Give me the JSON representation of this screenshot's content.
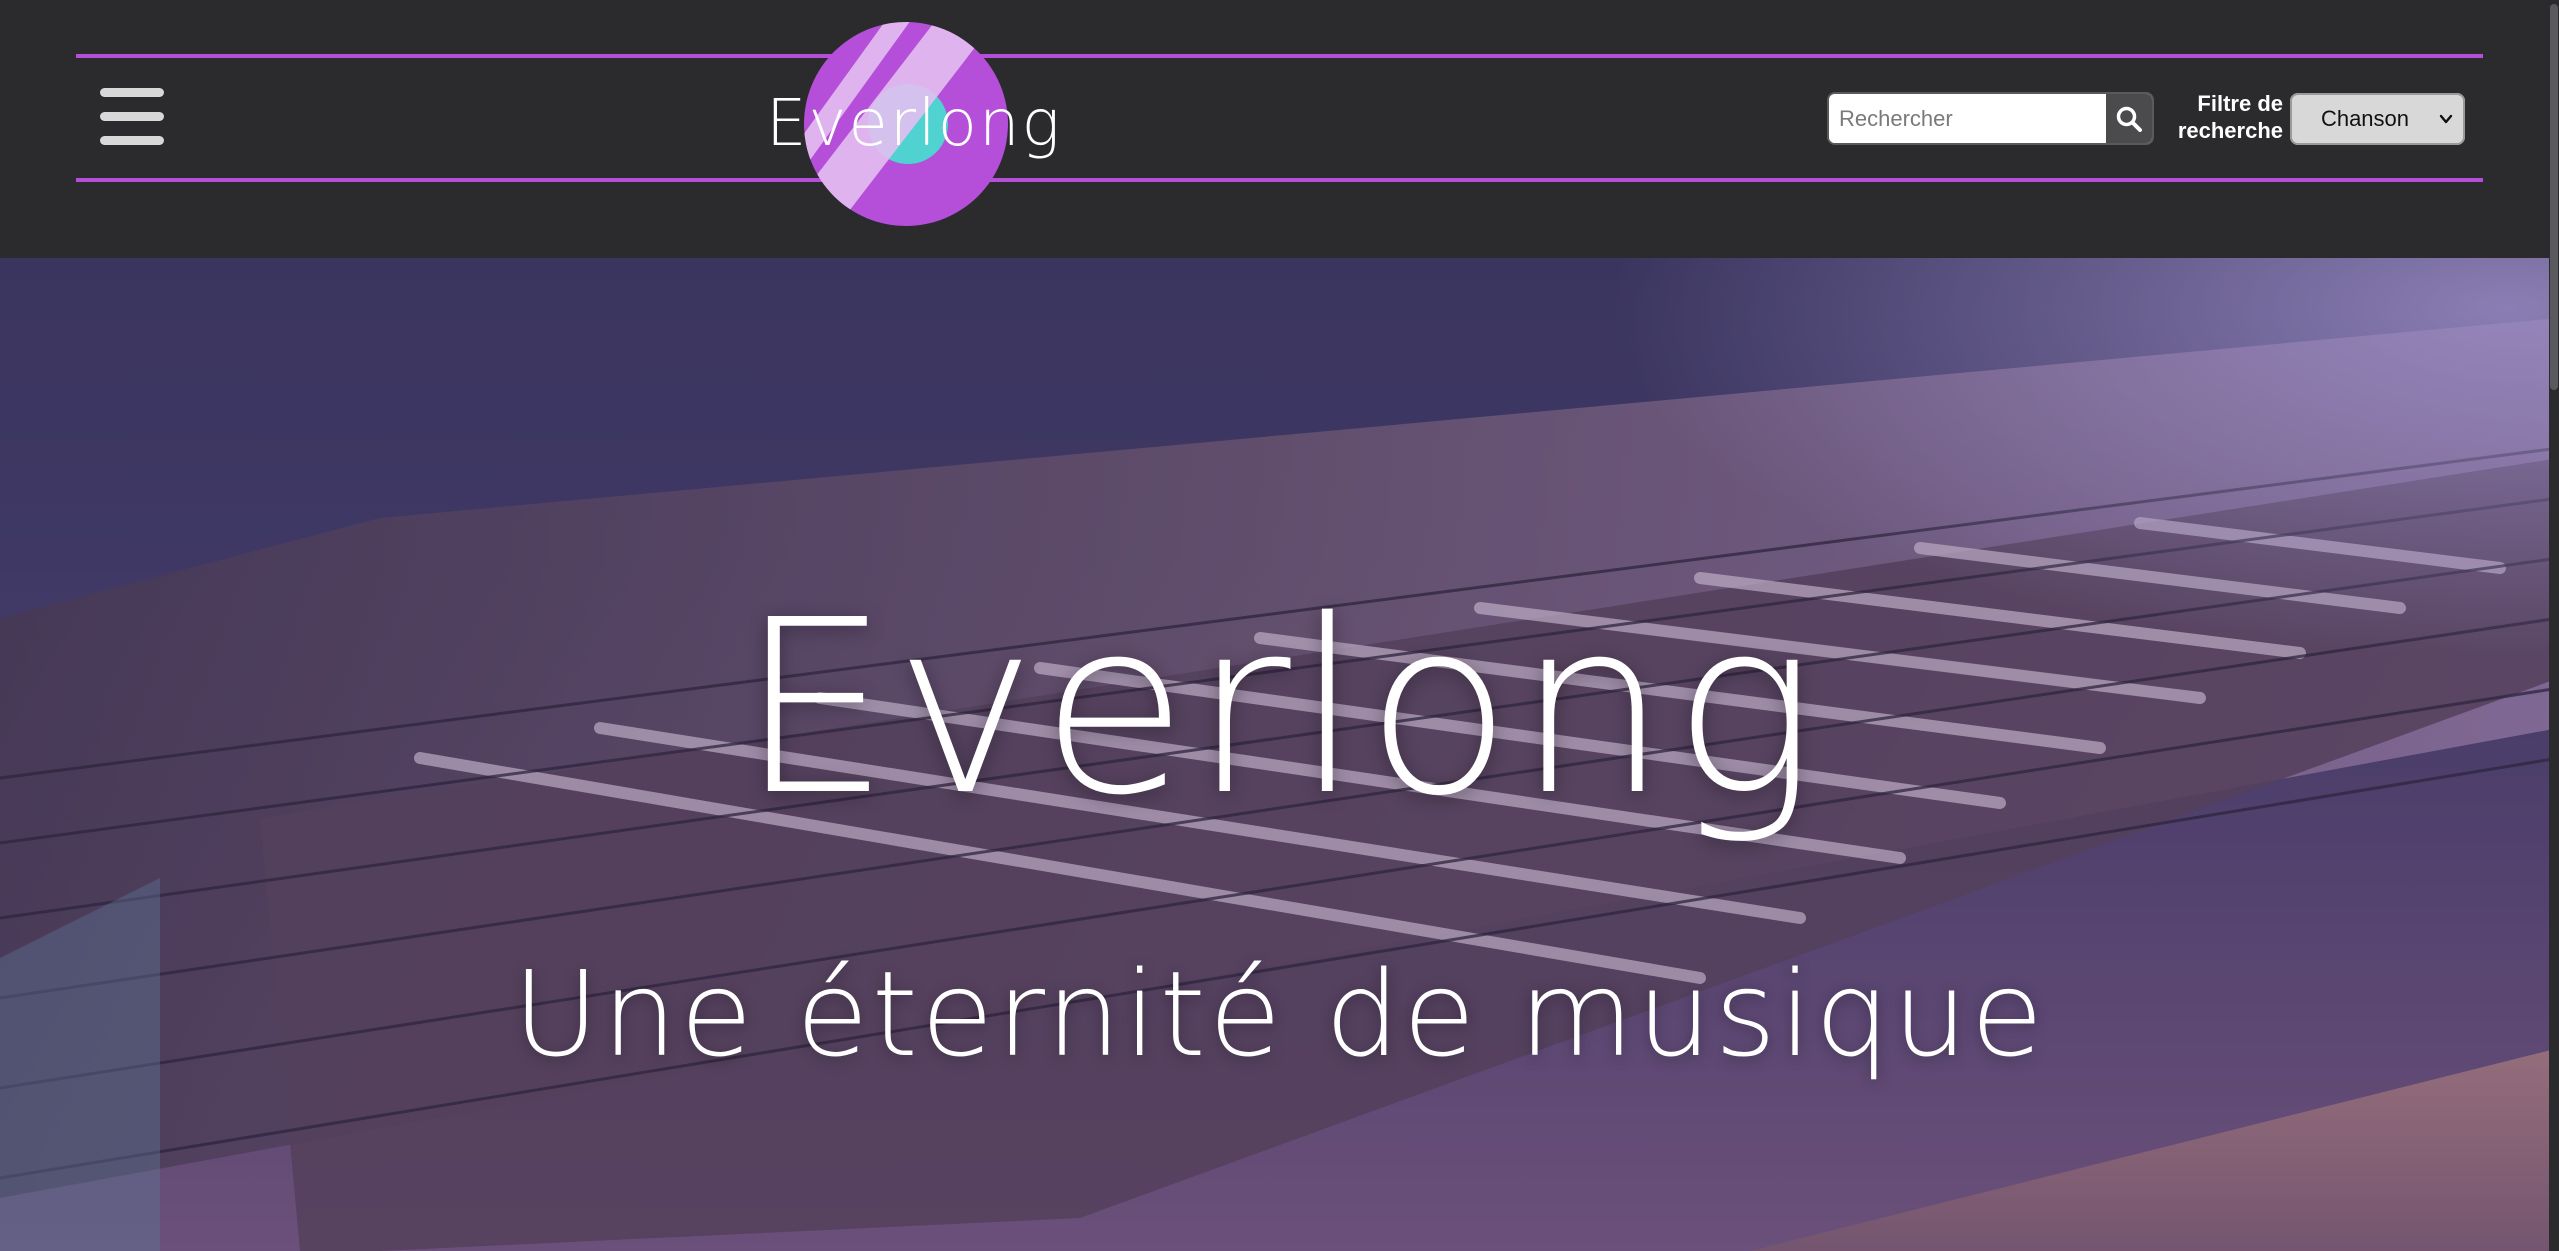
{
  "header": {
    "logo_text": "Everlong",
    "menu_icon": "hamburger-menu-icon",
    "search": {
      "placeholder": "Rechercher",
      "value": "",
      "button_icon": "search-icon"
    },
    "filter": {
      "label": "Filtre de recherche",
      "selected": "Chanson",
      "chevron_icon": "chevron-down-icon"
    }
  },
  "hero": {
    "title": "Everlong",
    "subtitle": "Une éternité de musique",
    "background": "guitar-fretboard-image"
  },
  "colors": {
    "header_bg": "#2b2b2d",
    "accent": "#b54fd9",
    "logo_circle": "#b54fd9",
    "logo_highlight": "#4fd2d0",
    "search_button": "#4b4b4e"
  }
}
